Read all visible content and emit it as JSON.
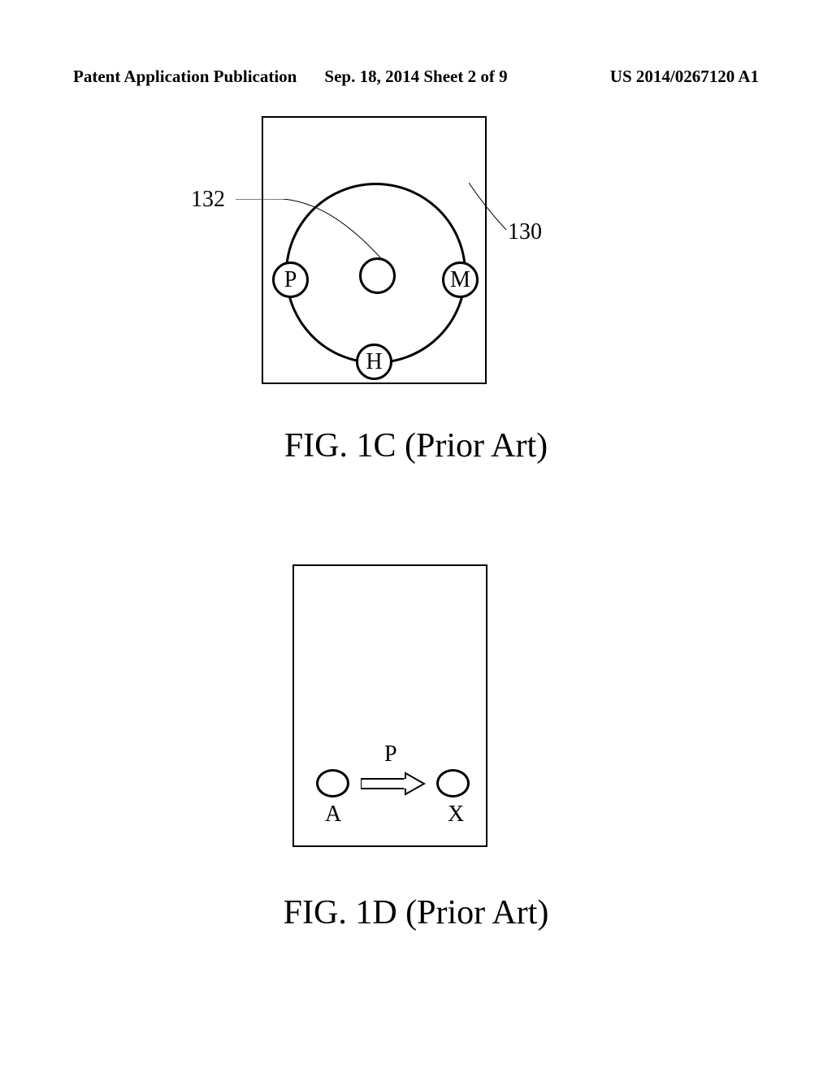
{
  "header": {
    "left": "Patent Application Publication",
    "center": "Sep. 18, 2014  Sheet 2 of 9",
    "right": "US 2014/0267120 A1"
  },
  "fig1c": {
    "label132": "132",
    "label130": "130",
    "letterP": "P",
    "letterM": "M",
    "letterH": "H",
    "caption": "FIG. 1C (Prior Art)"
  },
  "fig1d": {
    "letterP": "P",
    "letterA": "A",
    "letterX": "X",
    "caption": "FIG. 1D (Prior Art)"
  }
}
